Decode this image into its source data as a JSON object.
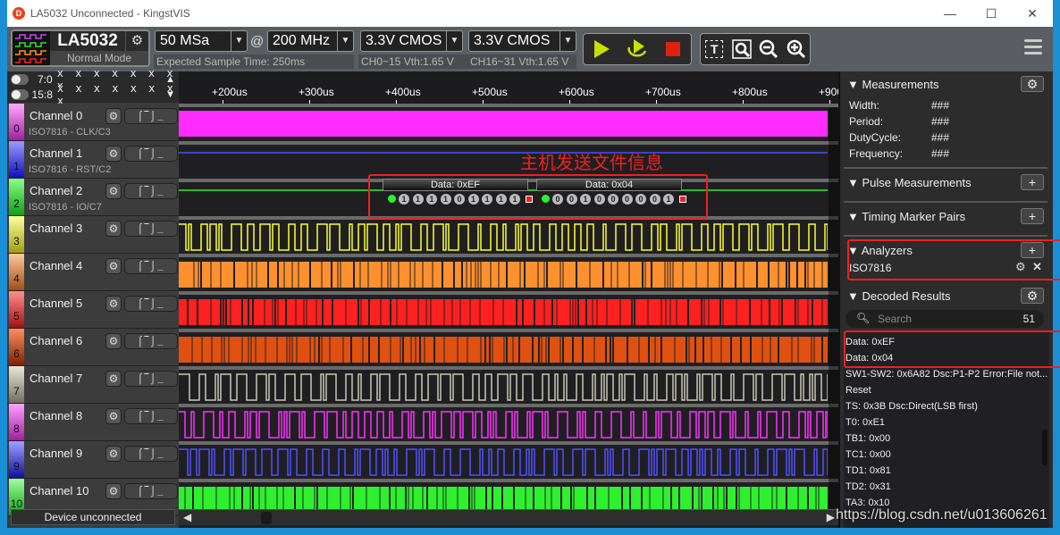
{
  "window": {
    "title": "LA5032 Unconnected - KingstVIS",
    "minimize": "—",
    "maximize": "☐",
    "close": "✕"
  },
  "toolbar": {
    "device_name": "LA5032",
    "device_mode": "Normal Mode",
    "sample_depth": "50 MSa",
    "sample_rate": "200 MHz",
    "at_symbol": "@",
    "expected_time": "Expected Sample Time: 250ms",
    "voltage_a": "3.3V CMOS",
    "voltage_b": "3.3V CMOS",
    "vth_a": "CH0~15 Vth:1.65 V",
    "vth_b": "CH16~31 Vth:1.65 V",
    "icons": [
      "play-icon",
      "loop-play-icon",
      "stop-icon",
      "text-marker-icon",
      "zoom-fit-icon",
      "zoom-out-icon",
      "zoom-in-icon",
      "menu-icon"
    ]
  },
  "bus": [
    {
      "label": "7:0",
      "value": "x x x x x x x x",
      "arrow": "▲"
    },
    {
      "label": "15:8",
      "value": "x x x x x x x x",
      "arrow": "▼"
    }
  ],
  "ruler": {
    "ticks": [
      "+200us",
      "+300us",
      "+400us",
      "+500us",
      "+600us",
      "+700us",
      "+800us",
      "+900"
    ]
  },
  "channels": [
    {
      "num": "0",
      "name": "Channel 0",
      "sub": "ISO7816 - CLK/C3",
      "color": "#ff2bff",
      "label_grad": [
        "#ffaaff",
        "#a020a0"
      ],
      "pattern": "solid"
    },
    {
      "num": "1",
      "name": "Channel 1",
      "sub": "ISO7816 - RST/C2",
      "color": "#4b4bff",
      "label_grad": [
        "#9a9aff",
        "#1010c0"
      ],
      "pattern": "low"
    },
    {
      "num": "2",
      "name": "Channel 2",
      "sub": "ISO7816 - IO/C7",
      "color": "#2ef02e",
      "label_grad": [
        "#8aff8a",
        "#10a010"
      ],
      "pattern": "high"
    },
    {
      "num": "3",
      "name": "Channel 3",
      "sub": "",
      "color": "#ffff30",
      "label_grad": [
        "#ffffa0",
        "#a0a010"
      ],
      "pattern": "square"
    },
    {
      "num": "4",
      "name": "Channel 4",
      "sub": "",
      "color": "#ff9030",
      "label_grad": [
        "#ffc8a0",
        "#a05010"
      ],
      "pattern": "dense"
    },
    {
      "num": "5",
      "name": "Channel 5",
      "sub": "",
      "color": "#ff2020",
      "label_grad": [
        "#ff9090",
        "#a01010"
      ],
      "pattern": "dense"
    },
    {
      "num": "6",
      "name": "Channel 6",
      "sub": "",
      "color": "#e05010",
      "label_grad": [
        "#ff9060",
        "#802000"
      ],
      "pattern": "dense"
    },
    {
      "num": "7",
      "name": "Channel 7",
      "sub": "",
      "color": "#c8c8b4",
      "label_grad": [
        "#e8e8d8",
        "#707060"
      ],
      "pattern": "square"
    },
    {
      "num": "8",
      "name": "Channel 8",
      "sub": "",
      "color": "#ff30ff",
      "label_grad": [
        "#ffa0ff",
        "#a020a0"
      ],
      "pattern": "square"
    },
    {
      "num": "9",
      "name": "Channel 9",
      "sub": "",
      "color": "#5050ff",
      "label_grad": [
        "#a0a0ff",
        "#1010a0"
      ],
      "pattern": "square"
    },
    {
      "num": "10",
      "name": "Channel 10",
      "sub": "",
      "color": "#2ef02e",
      "label_grad": [
        "#a0ffa0",
        "#10a010"
      ],
      "pattern": "dense"
    }
  ],
  "channel_icons": {
    "gear": "⚙",
    "trigger": "⌠‾⌡_"
  },
  "annotation": {
    "text": "主机发送文件信息",
    "frames": [
      {
        "label": "Data: 0xEF",
        "bits": [
          "1",
          "1",
          "1",
          "1",
          "0",
          "1",
          "1",
          "1",
          "1"
        ]
      },
      {
        "label": "Data: 0x04",
        "bits": [
          "0",
          "0",
          "1",
          "0",
          "0",
          "0",
          "0",
          "0",
          "1"
        ]
      }
    ]
  },
  "status": {
    "device": "Device unconnected"
  },
  "right_panel": {
    "measurements": {
      "title": "Measurements",
      "rows": [
        {
          "label": "Width:",
          "value": "###"
        },
        {
          "label": "Period:",
          "value": "###"
        },
        {
          "label": "DutyCycle:",
          "value": "###"
        },
        {
          "label": "Frequency:",
          "value": "###"
        }
      ]
    },
    "pulse_title": "Pulse Measurements",
    "timing_title": "Timing Marker Pairs",
    "analyzers": {
      "title": "Analyzers",
      "items": [
        "ISO7816"
      ]
    },
    "decoded": {
      "title": "Decoded Results",
      "search_placeholder": "Search",
      "count": "51",
      "results": [
        "Data: 0xEF",
        "Data: 0x04",
        "SW1-SW2: 0x6A82 Dsc:P1-P2 Error:File not...",
        "Reset",
        "TS: 0x3B Dsc:Direct(LSB first)",
        "T0: 0xE1",
        "TB1: 0x00",
        "TC1: 0x00",
        "TD1: 0x81",
        "TD2: 0x31",
        "TA3: 0x10"
      ]
    }
  },
  "watermark": "https://blog.csdn.net/u013606261"
}
